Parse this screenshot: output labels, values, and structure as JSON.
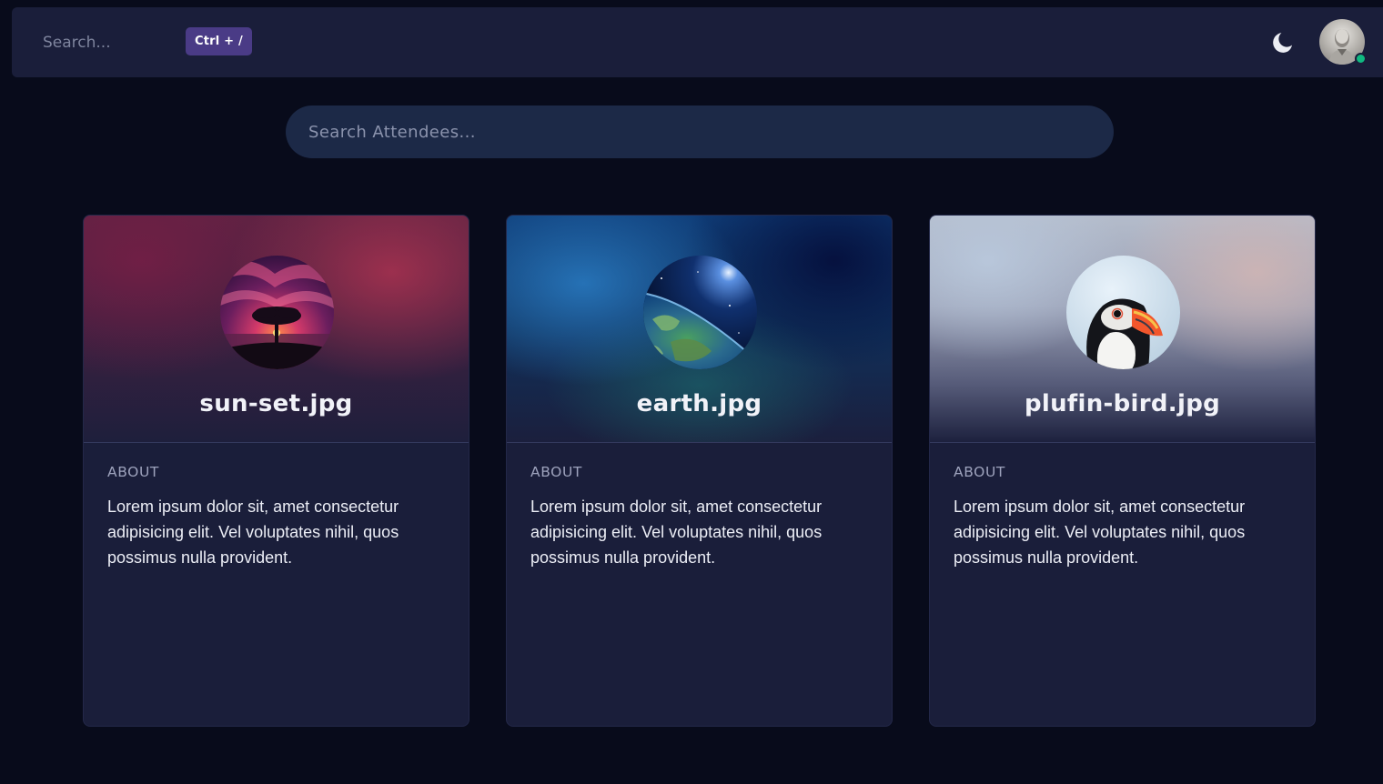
{
  "topbar": {
    "search_placeholder": "Search...",
    "shortcut": "Ctrl + /",
    "theme_icon": "moon-icon",
    "avatar_status": "online",
    "status_color": "#10b981"
  },
  "attendee_search": {
    "placeholder": "Search Attendees..."
  },
  "cards": [
    {
      "title": "sun-set.jpg",
      "about_label": "ABOUT",
      "about_text": "Lorem ipsum dolor sit, amet consectetur adipisicing elit. Vel voluptates nihil, quos possimus nulla provident."
    },
    {
      "title": "earth.jpg",
      "about_label": "ABOUT",
      "about_text": "Lorem ipsum dolor sit, amet consectetur adipisicing elit. Vel voluptates nihil, quos possimus nulla provident."
    },
    {
      "title": "plufin-bird.jpg",
      "about_label": "ABOUT",
      "about_text": "Lorem ipsum dolor sit, amet consectetur adipisicing elit. Vel voluptates nihil, quos possimus nulla provident."
    }
  ]
}
